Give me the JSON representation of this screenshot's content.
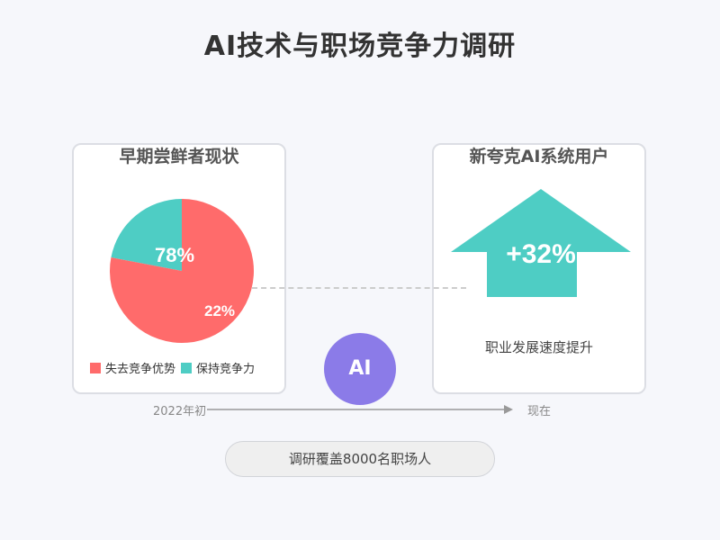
{
  "title": "AI技术与职场竞争力调研",
  "left_card": {
    "title": "早期尝鲜者现状",
    "pie_labels": {
      "keep": "78%",
      "lose": "22%"
    },
    "legend": [
      {
        "label": "失去竞争优势",
        "color": "#ff6b6b"
      },
      {
        "label": "保持竞争力",
        "color": "#4ecdc4"
      }
    ]
  },
  "right_card": {
    "title": "新夸克AI系统用户",
    "arrow_value": "+32%",
    "arrow_color": "#4ecdc4",
    "caption": "职业发展速度提升"
  },
  "ai_badge": "AI",
  "timeline": {
    "start": "2022年初",
    "end": "现在"
  },
  "survey_note": "调研覆盖8000名职场人",
  "chart_data": {
    "type": "pie",
    "slices": [
      {
        "label": "失去竞争优势",
        "value": 22,
        "display": "22%",
        "color": "#ff6b6b"
      },
      {
        "label": "保持竞争力",
        "value": 78,
        "display": "78%",
        "color": "#4ecdc4"
      }
    ]
  }
}
